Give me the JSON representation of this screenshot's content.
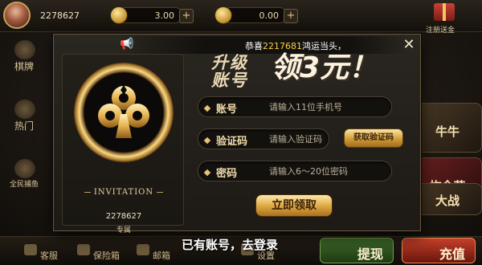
{
  "topbar": {
    "user_id": "2278627",
    "coins": "3.00",
    "tickets": "0.00",
    "plus": "+",
    "gift_label": "注册送金"
  },
  "side_nav": [
    "棋牌",
    "热门",
    "全民捕鱼"
  ],
  "right_games": [
    "牛牛",
    "炸金花",
    "大战"
  ],
  "bottom": {
    "items": [
      "客服",
      "保险箱",
      "邮箱",
      "设置"
    ],
    "withdraw": "提现",
    "recharge": "充值"
  },
  "modal": {
    "announcement_prefix": "恭喜",
    "announcement_id": "2217681",
    "announcement_suffix": "鸿运当头，",
    "close": "✕",
    "promo_line1": "升级",
    "promo_line2": "账号",
    "promo_big": "领3元！",
    "invitation": "INVITATION",
    "invite_id": "2278627",
    "invite_tag": "专属",
    "fields": {
      "account_label": "账号",
      "account_placeholder": "请输入11位手机号",
      "code_label": "验证码",
      "code_placeholder": "请输入验证码",
      "password_label": "密码",
      "password_placeholder": "请输入6～20位密码"
    },
    "get_code_button": "获取验证码",
    "submit_button": "立即领取"
  },
  "login_link": "已有账号，去登录",
  "colors": {
    "accent_gold": "#e0ab45",
    "highlight_yellow": "#ffd33d"
  }
}
